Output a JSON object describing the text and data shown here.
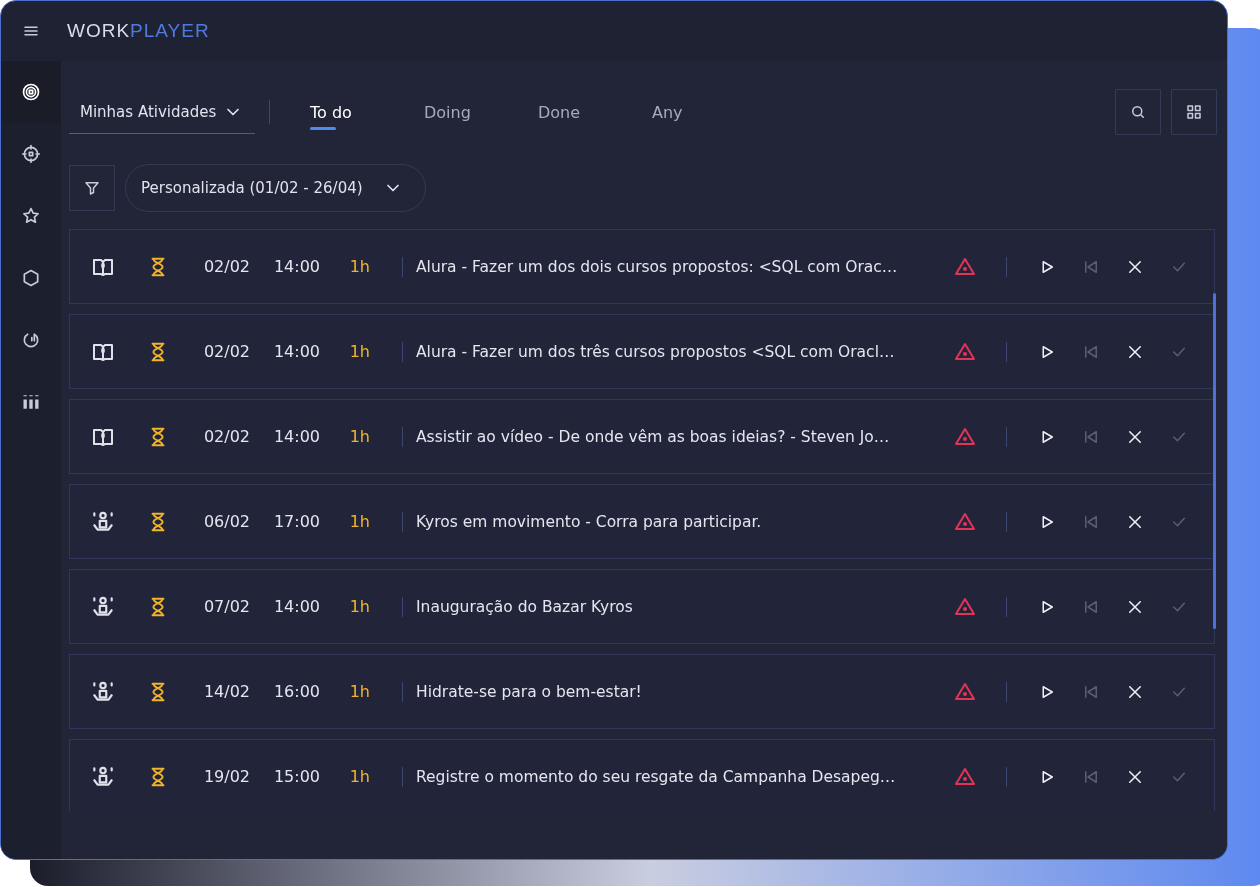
{
  "brand": {
    "first": "WORK",
    "second": "PLAYER"
  },
  "sidebar": {
    "items": [
      {
        "kind": "target",
        "selected": true
      },
      {
        "kind": "crosshair",
        "selected": false
      },
      {
        "kind": "star",
        "selected": false
      },
      {
        "kind": "hexagon",
        "selected": false
      },
      {
        "kind": "gauge",
        "selected": false
      },
      {
        "kind": "bars",
        "selected": false
      }
    ]
  },
  "view_select": {
    "value": "Minhas Atividades"
  },
  "tabs": [
    {
      "label": "To do",
      "selected": true
    },
    {
      "label": "Doing",
      "selected": false
    },
    {
      "label": "Done",
      "selected": false
    },
    {
      "label": "Any",
      "selected": false
    }
  ],
  "period_select": {
    "value": "Personalizada (01/02 - 26/04)"
  },
  "activities": [
    {
      "kind": "course",
      "date": "02/02",
      "time": "14:00",
      "duration": "1h",
      "title": "Alura - Fazer um dos dois cursos propostos: <SQL com Orac…"
    },
    {
      "kind": "course",
      "date": "02/02",
      "time": "14:00",
      "duration": "1h",
      "title": "Alura - Fazer um dos três cursos propostos <SQL com Oracl…"
    },
    {
      "kind": "course",
      "date": "02/02",
      "time": "14:00",
      "duration": "1h",
      "title": "Assistir ao vídeo - De onde vêm as boas ideias? - Steven Jo…"
    },
    {
      "kind": "event",
      "date": "06/02",
      "time": "17:00",
      "duration": "1h",
      "title": "Kyros em movimento - Corra para participar."
    },
    {
      "kind": "event",
      "date": "07/02",
      "time": "14:00",
      "duration": "1h",
      "title": "Inauguração do Bazar Kyros"
    },
    {
      "kind": "event",
      "date": "14/02",
      "time": "16:00",
      "duration": "1h",
      "title": "Hidrate-se para o bem-estar!"
    },
    {
      "kind": "event",
      "date": "19/02",
      "time": "15:00",
      "duration": "1h",
      "title": "Registre o momento do seu resgate da Campanha Desapeg…"
    }
  ]
}
